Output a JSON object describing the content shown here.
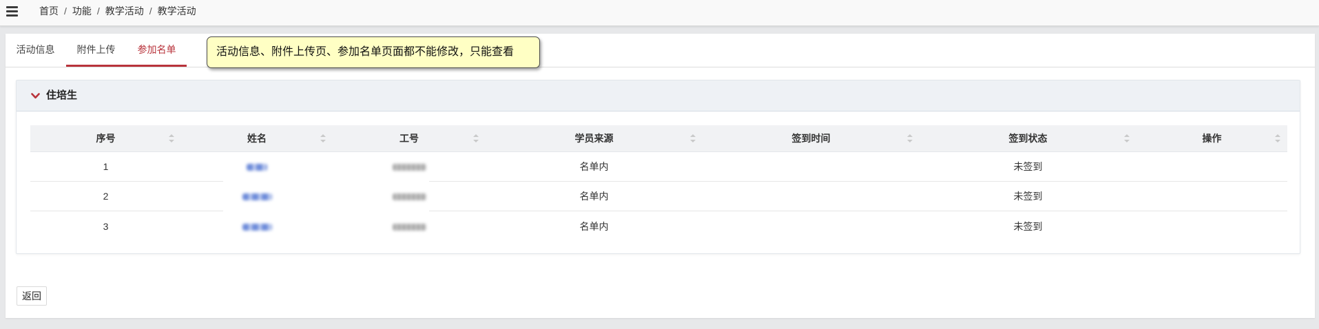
{
  "topbar": {
    "menu_icon": "hamburger-menu-icon",
    "breadcrumb": [
      "首页",
      "功能",
      "教学活动",
      "教学活动"
    ],
    "separator": "/"
  },
  "tabs": [
    {
      "label": "活动信息",
      "active": false
    },
    {
      "label": "附件上传",
      "active": false
    },
    {
      "label": "参加名单",
      "active": true
    }
  ],
  "tooltip": {
    "text": "活动信息、附件上传页、参加名单页面都不能修改，只能查看"
  },
  "panel": {
    "title": "住培生",
    "toggle_icon": "chevron-down-icon",
    "expanded": true,
    "table": {
      "columns": [
        "序号",
        "姓名",
        "工号",
        "学员来源",
        "签到时间",
        "签到状态",
        "操作"
      ],
      "sort_icon": "sort-icon",
      "rows": [
        {
          "index": "1",
          "source": "名单内",
          "sign_status": "未签到"
        },
        {
          "index": "2",
          "source": "名单内",
          "sign_status": "未签到"
        },
        {
          "index": "3",
          "source": "名单内",
          "sign_status": "未签到"
        }
      ]
    }
  },
  "footer": {
    "back_label": "返回"
  },
  "colors": {
    "accent": "#b8333b",
    "tooltip_background": "#ffffc4",
    "link": "#3f6fd0",
    "page_background": "#e7e8ea"
  }
}
